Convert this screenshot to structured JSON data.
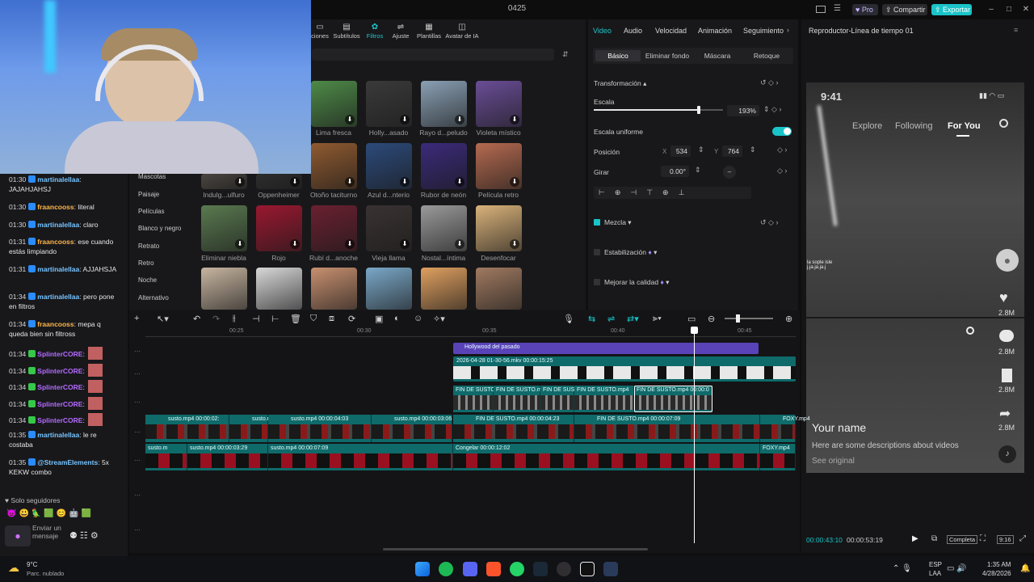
{
  "window": {
    "title": "0425",
    "pro": "Pro",
    "share": "Compartir",
    "export": "Exportar"
  },
  "tools": [
    {
      "label": "ciones"
    },
    {
      "label": "Subtítulos"
    },
    {
      "label": "Filtros"
    },
    {
      "label": "Ajuste"
    },
    {
      "label": "Plantillas"
    },
    {
      "label": "Avatar de IA"
    }
  ],
  "categories": [
    "Mascotas",
    "Paisaje",
    "Películas",
    "Blanco y negro",
    "Retrato",
    "Retro",
    "Noche",
    "Alternativo"
  ],
  "filters": [
    {
      "name": "Lima fresca",
      "color": "#4e8a48"
    },
    {
      "name": "Holly...asado",
      "color": "#3a3a3a"
    },
    {
      "name": "Rayo d...peludo",
      "color": "#8aa0b4"
    },
    {
      "name": "Violeta místico",
      "color": "#6a4d96"
    },
    {
      "name": "Indulg...ulfuro",
      "color": "#4a4540"
    },
    {
      "name": "Oppenheimer",
      "color": "#2d2d2d"
    },
    {
      "name": "Otoño taciturno",
      "color": "#8f5a30"
    },
    {
      "name": "Azul d...nterio",
      "color": "#2c4a7a"
    },
    {
      "name": "Rubor de neón",
      "color": "#3b2a7a"
    },
    {
      "name": "Película retro",
      "color": "#b56a50"
    },
    {
      "name": "Eliminar niebla",
      "color": "#5a7a50"
    },
    {
      "name": "Rojo",
      "color": "#9a1830"
    },
    {
      "name": "Rubí d...anoche",
      "color": "#6a2030"
    },
    {
      "name": "Vieja llama",
      "color": "#3a3232"
    },
    {
      "name": "Nostal...íntima",
      "color": "#9a9a9a"
    },
    {
      "name": "Desenfocar",
      "color": "#d9b27a"
    },
    {
      "name": "",
      "color": "#c7b5a0"
    },
    {
      "name": "",
      "color": "#d8d8d8"
    },
    {
      "name": "",
      "color": "#c89070"
    },
    {
      "name": "",
      "color": "#7aa8c8"
    },
    {
      "name": "",
      "color": "#e0a060"
    },
    {
      "name": "",
      "color": "#a07a60"
    }
  ],
  "chat": [
    {
      "time": "01:30",
      "user": "martinalellaa",
      "cls": "u1",
      "msg": "JAJAHJAHSJ",
      "lines": 2
    },
    {
      "time": "01:30",
      "user": "fraancooss",
      "cls": "u2",
      "msg": "literal",
      "lines": 1
    },
    {
      "time": "01:30",
      "user": "martinalellaa",
      "cls": "u1",
      "msg": "claro",
      "lines": 1
    },
    {
      "time": "01:31",
      "user": "fraancooss",
      "cls": "u2",
      "msg": "ese cuando estás limpiando",
      "lines": 2
    },
    {
      "time": "01:31",
      "user": "martinalellaa",
      "cls": "u1",
      "msg": "AJJAHSJA",
      "lines": 2
    },
    {
      "time": "01:34",
      "user": "martinalellaa",
      "cls": "u1",
      "msg": "pero pone en filtros",
      "lines": 2
    },
    {
      "time": "01:34",
      "user": "fraancooss",
      "cls": "u2",
      "msg": "mepa q queda bien sin filtross",
      "lines": 2
    },
    {
      "time": "01:34",
      "user": "SplinterCORE",
      "cls": "u3",
      "msg": "",
      "lines": 1
    },
    {
      "time": "01:34",
      "user": "SplinterCORE",
      "cls": "u3",
      "msg": "",
      "lines": 1
    },
    {
      "time": "01:34",
      "user": "SplinterCORE",
      "cls": "u3",
      "msg": "",
      "lines": 1
    },
    {
      "time": "01:34",
      "user": "SplinterCORE",
      "cls": "u3",
      "msg": "",
      "lines": 1
    },
    {
      "time": "01:34",
      "user": "SplinterCORE",
      "cls": "u3",
      "msg": "",
      "lines": 1
    },
    {
      "time": "01:35",
      "user": "martinalellaa",
      "cls": "u1",
      "msg": "le re costaba",
      "lines": 2
    },
    {
      "time": "01:35",
      "user": "@StreamElements",
      "cls": "u1",
      "msg": "5x KEKW combo",
      "lines": 3
    }
  ],
  "chat_footer": {
    "followers": "Solo seguidores",
    "send": "Enviar un mensaje"
  },
  "props": {
    "tabs": [
      "Video",
      "Audio",
      "Velocidad",
      "Animación",
      "Seguimiento"
    ],
    "subtabs": [
      "Básico",
      "Eliminar fondo",
      "Máscara",
      "Retoque"
    ],
    "transform": "Transformación",
    "scale": "Escala",
    "scale_val": "193%",
    "uniform": "Escala uniforme",
    "position": "Posición",
    "x_label": "X",
    "x_val": "534",
    "y_label": "Y",
    "y_val": "764",
    "rotate": "Girar",
    "rotate_val": "0.00°",
    "blend": "Mezcla",
    "stabilize": "Estabilización",
    "enhance": "Mejorar la calidad",
    "scale_fraction": 0.8
  },
  "player": {
    "title": "Reproductor-Línea de tiempo 01",
    "time": "9:41",
    "nav": [
      "Explore",
      "Following",
      "For You"
    ],
    "likes": "2.8M",
    "comments": "2.8M",
    "saves": "2.8M",
    "shares": "2.8M",
    "name": "Your name",
    "desc": "Here are some descriptions about videos",
    "see": "See original",
    "overlay": "la sople isle\nj.ja.ja.ja.j",
    "current": "00:00:43:10",
    "total": "00:00:53:19",
    "mode": "Completa",
    "ratio": "9:16"
  },
  "ruler": [
    "00:25",
    "00:30",
    "00:35",
    "00:40",
    "00:45"
  ],
  "tracks": {
    "effect": "Hollywood del pasado",
    "mkv": "2026-04-28 01-30-56.mkv   00:00:15:25",
    "fin": [
      "FIN DE SUSTO",
      "FIN DE SUSTO.mp",
      "FIN DE SUSTO.mp",
      "FIN DE SUSTO.mp4",
      "FIN DE SUSTO.mp4  00:00:0"
    ],
    "row1": [
      "susto.mp4   00:00:02:",
      "susto.mp4",
      "susto.mp4   00:00:04:03",
      "susto.mp4   00:00:03:06",
      "FIN DE SUSTO.mp4   00:00:04:23",
      "FIN DE SUSTO.mp4   00:00:07:09",
      "FOXY.mp4"
    ],
    "row2": [
      "susto.m",
      "susto.mp4   00:00:03:29",
      "susto.mp4   00:00:07:09",
      "Congelar   00:00:12:02",
      "FOXY.mp4"
    ]
  },
  "taskbar": {
    "weather": "9°C",
    "weather_desc": "Parc. nublado",
    "lang": "ESP",
    "lang2": "LAA",
    "clock": "1:35 AM",
    "date": "4/28/2026"
  }
}
